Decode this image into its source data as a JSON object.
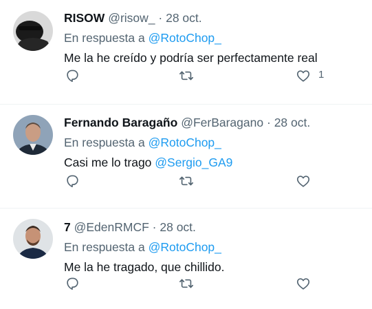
{
  "tweets": [
    {
      "name": "RISOW",
      "handle": "@risow_",
      "separator": "·",
      "date": "28 oct.",
      "reply_prefix": "En respuesta a",
      "reply_to": "@RotoChop_",
      "text": "Me la he creído y podría ser perfectamente real",
      "like_count": "1"
    },
    {
      "name": "Fernando Baragaño",
      "handle": "@FerBaragano",
      "separator": "·",
      "date": "28 oct.",
      "reply_prefix": "En respuesta a",
      "reply_to": "@RotoChop_",
      "text": "Casi me lo trago",
      "mention": "@Sergio_GA9"
    },
    {
      "name": "7",
      "handle": "@EdenRMCF",
      "separator": "·",
      "date": "28 oct.",
      "reply_prefix": "En respuesta a",
      "reply_to": "@RotoChop_",
      "text": "Me la he tragado, que chillido."
    }
  ],
  "icons": {
    "reply": "reply-icon",
    "retweet": "retweet-icon",
    "like": "like-icon"
  },
  "colors": {
    "link": "#1d9bf0",
    "muted": "#536471",
    "text": "#0f1419",
    "divider": "#eff3f4"
  }
}
